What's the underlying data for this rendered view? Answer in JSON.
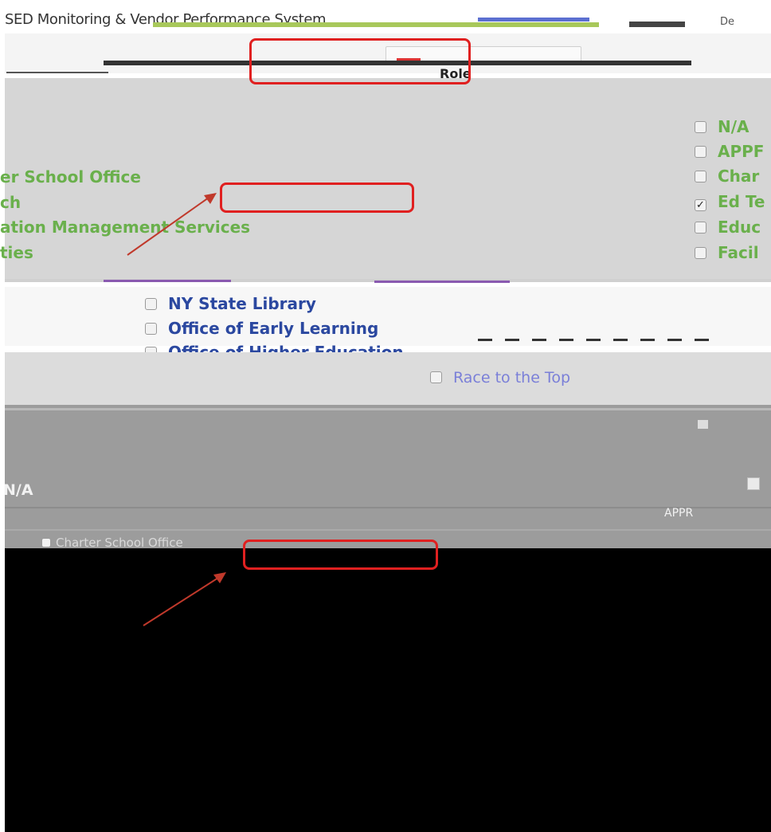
{
  "window": {
    "title": "SED Monitoring & Vendor Performance System",
    "title_right": "De"
  },
  "panel": {
    "header": "Role",
    "left_items": [
      "er School Office",
      "ch",
      "ation Management Services",
      "ties"
    ],
    "right_items": [
      {
        "label": "N/A",
        "checked": false
      },
      {
        "label": "APPF",
        "checked": false
      },
      {
        "label": "Char",
        "checked": false
      },
      {
        "label": "Ed Te",
        "checked": true
      },
      {
        "label": "Educ",
        "checked": false
      },
      {
        "label": "Facil",
        "checked": false
      }
    ]
  },
  "offices": [
    {
      "label": "NY State Library",
      "checked": false
    },
    {
      "label": "Office of Early Learning",
      "checked": false
    },
    {
      "label": "Office of Higher Education",
      "checked": false
    }
  ],
  "lower": {
    "race_item": "Race to the Top",
    "na_label": "N/A",
    "appr_label": "APPR",
    "charter_label": "Charter School Office"
  },
  "colors": {
    "highlight": "#e02020",
    "arrow": "#c0392b",
    "green_label": "#6ab04c",
    "blue_label": "#2b48a0"
  }
}
